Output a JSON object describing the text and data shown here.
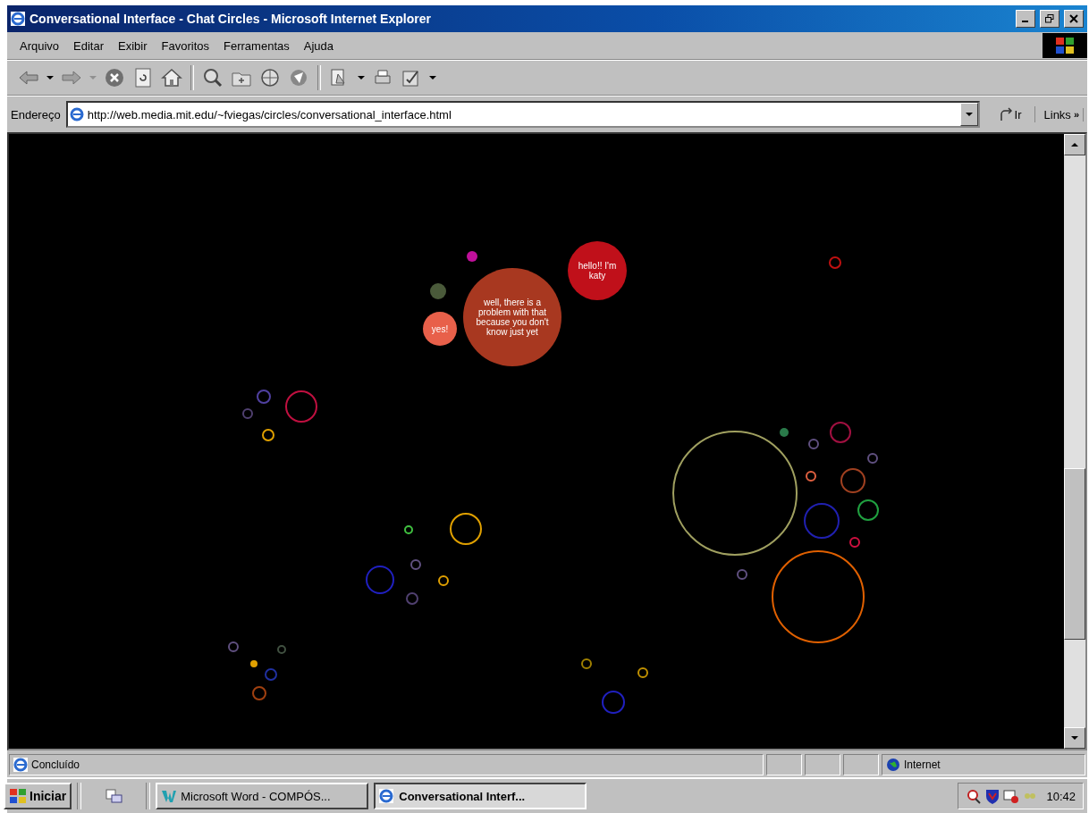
{
  "window": {
    "title": "Conversational Interface - Chat Circles - Microsoft Internet Explorer"
  },
  "menu": [
    "Arquivo",
    "Editar",
    "Exibir",
    "Favoritos",
    "Ferramentas",
    "Ajuda"
  ],
  "address_bar": {
    "label": "Endereço",
    "value": "http://web.media.mit.edu/~fviegas/circles/conversational_interface.html",
    "go_label": "Ir",
    "links_label": "Links",
    "links_more": "»"
  },
  "circles": [
    {
      "kind": "bubble",
      "color": "#c0109a"
    },
    {
      "kind": "bubble",
      "color": "#c0101a",
      "text": "hello!! I'm katy"
    },
    {
      "kind": "bubble",
      "color": "#4a5a3a"
    },
    {
      "kind": "bubble",
      "color": "#e8604a",
      "text": "yes!"
    },
    {
      "kind": "bubble",
      "color": "#a83820",
      "text": "well, there is a problem with that because you don't know just yet"
    },
    {
      "kind": "bubble",
      "color": "#2a7a4a"
    },
    {
      "kind": "bubble",
      "color": "#e0a000"
    },
    {
      "kind": "ring",
      "color": "#c01010"
    },
    {
      "kind": "ring",
      "color": "#c01040"
    },
    {
      "kind": "ring",
      "color": "#5040a0"
    },
    {
      "kind": "ring",
      "color": "#504070"
    },
    {
      "kind": "ring",
      "color": "#e0a000"
    },
    {
      "kind": "ring",
      "color": "#a0a060"
    },
    {
      "kind": "ring",
      "color": "#a01040"
    },
    {
      "kind": "ring",
      "color": "#605080"
    },
    {
      "kind": "ring",
      "color": "#605080"
    },
    {
      "kind": "ring",
      "color": "#e06040"
    },
    {
      "kind": "ring",
      "color": "#a04020"
    },
    {
      "kind": "ring",
      "color": "#20a040"
    },
    {
      "kind": "ring",
      "color": "#2020b0"
    },
    {
      "kind": "ring",
      "color": "#d01040"
    },
    {
      "kind": "ring",
      "color": "#e06000"
    },
    {
      "kind": "ring",
      "color": "#605080"
    },
    {
      "kind": "ring",
      "color": "#e0a000"
    },
    {
      "kind": "ring",
      "color": "#40c040"
    },
    {
      "kind": "ring",
      "color": "#605080"
    },
    {
      "kind": "ring",
      "color": "#2020c0"
    },
    {
      "kind": "ring",
      "color": "#e0a000"
    },
    {
      "kind": "ring",
      "color": "#504070"
    },
    {
      "kind": "ring",
      "color": "#605080"
    },
    {
      "kind": "ring",
      "color": "#405040"
    },
    {
      "kind": "ring",
      "color": "#2030a0"
    },
    {
      "kind": "ring",
      "color": "#a04010"
    },
    {
      "kind": "ring",
      "color": "#a08000"
    },
    {
      "kind": "ring",
      "color": "#c09000"
    },
    {
      "kind": "ring",
      "color": "#2020c0"
    }
  ],
  "status_bar": {
    "text": "Concluído",
    "zone": "Internet"
  },
  "taskbar": {
    "start": "Iniciar",
    "tasks": [
      {
        "label": "Microsoft Word - COMPÓS...",
        "selected": false
      },
      {
        "label": "Conversational Interf...",
        "selected": true
      }
    ],
    "clock": "10:42"
  }
}
